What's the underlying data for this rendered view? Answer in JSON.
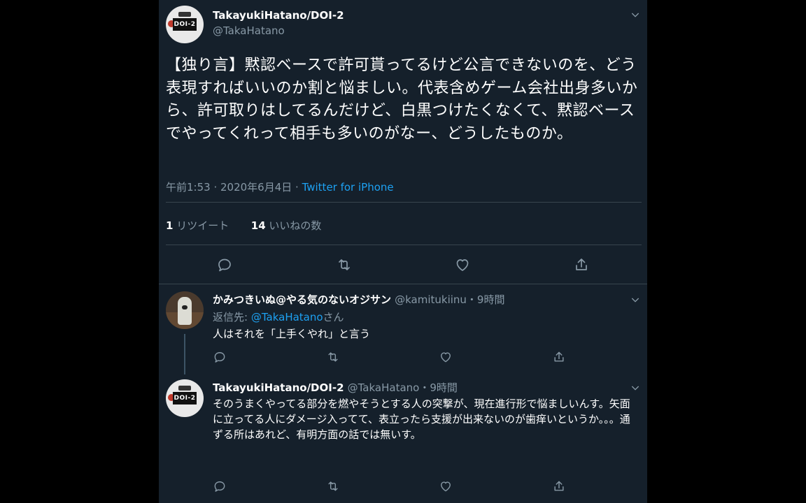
{
  "main_tweet": {
    "display_name": "TakayukiHatano/DOI-2",
    "handle": "@TakaHatano",
    "avatar_text": "DOI-2",
    "text": "【独り言】黙認ベースで許可貰ってるけど公言できないのを、どう表現すればいいのか割と悩ましい。代表含めゲーム会社出身多いから、許可取りはしてるんだけど、白黒つけたくなくて、黙認ベースでやってくれって相手も多いのがなー、どうしたものか。",
    "timestamp": "午前1:53 · 2020年6月4日 · ",
    "source": "Twitter for iPhone",
    "retweet_count": "1",
    "retweet_label": " リツイート",
    "like_count": "14",
    "like_label": " いいねの数"
  },
  "reply1": {
    "display_name": "かみつきいぬ@やる気のないオジサン",
    "handle_time": "@kamitukiinu・9時間",
    "reply_prefix": "返信先: ",
    "reply_mention": "@TakaHatano",
    "reply_suffix": "さん",
    "text": "人はそれを「上手くやれ」と言う"
  },
  "reply2": {
    "display_name": "TakayukiHatano/DOI-2",
    "handle_time": "@TakaHatano・9時間",
    "avatar_text": "DOI-2",
    "text": "そのうまくやってる部分を燃やそうとする人の突撃が、現在進行形で悩ましいんす。矢面に立ってる人にダメージ入ってて、表立ったら支援が出来ないのが歯痒いというか。。。通ずる所はあれど、有明方面の話では無いす。"
  },
  "colors": {
    "background": "#15202b",
    "accent": "#1da1f2",
    "muted": "#8899a6",
    "text": "#ffffff"
  },
  "icons": [
    "chevron-down-icon",
    "reply-icon",
    "retweet-icon",
    "like-icon",
    "share-icon"
  ]
}
